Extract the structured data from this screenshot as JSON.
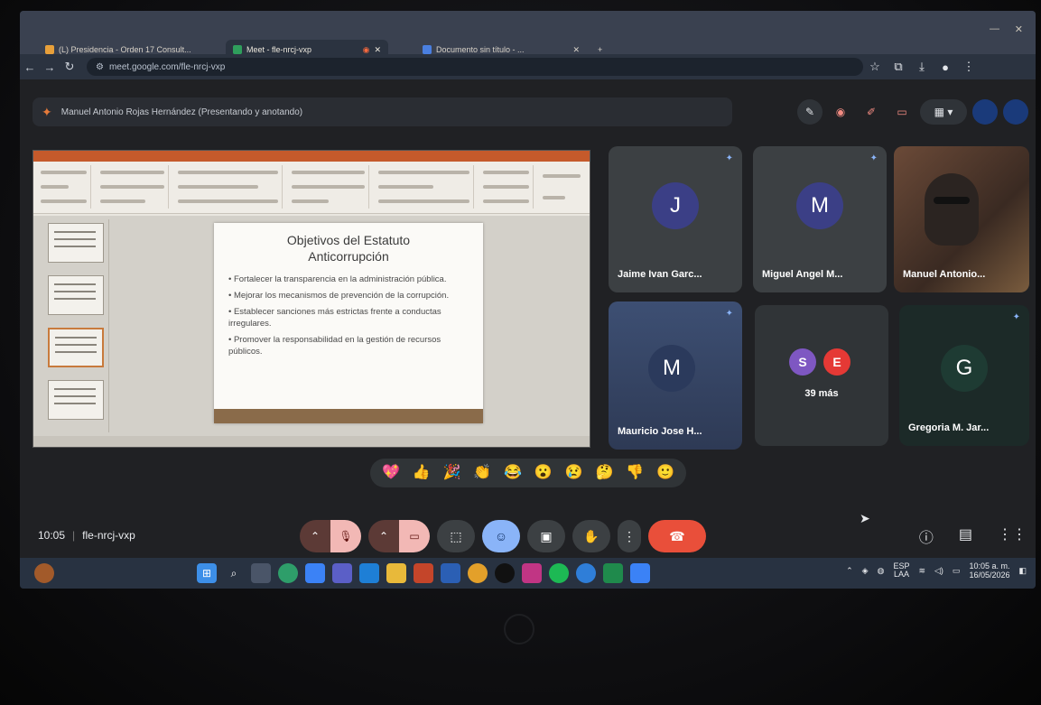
{
  "browser": {
    "tabs": [
      {
        "label": "(L) Presidencia - Orden 17 Consult..."
      },
      {
        "label": "Meet - fle-nrcj-vxp"
      },
      {
        "label": "Documento sin título - ..."
      }
    ],
    "new_tab": "+",
    "url": "meet.google.com/fle-nrcj-vxp"
  },
  "meet": {
    "presenter_text": "Manuel Antonio Rojas Hernández (Presentando y anotando)",
    "call_time": "10:05",
    "meeting_code": "fle-nrcj-vxp"
  },
  "slide": {
    "title_line1": "Objetivos del Estatuto",
    "title_line2": "Anticorrupción",
    "bullets": [
      "• Fortalecer la transparencia en la administración pública.",
      "• Mejorar los mecanismos de prevención de la corrupción.",
      "• Establecer sanciones más estrictas frente a conductas irregulares.",
      "• Promover la responsabilidad en la gestión de recursos públicos."
    ]
  },
  "participants": [
    {
      "initial": "J",
      "name": "Jaime Ivan Garc...",
      "color": "#3b3f86"
    },
    {
      "initial": "M",
      "name": "Miguel Angel M...",
      "color": "#3b3f86"
    },
    {
      "initial": "",
      "name": "Manuel Antonio...",
      "color": "#6b4a38"
    },
    {
      "initial": "M",
      "name": "Mauricio Jose H...",
      "color": "#3a4c72"
    },
    {
      "initial": "G",
      "name": "Gregoria M. Jar...",
      "color": "#1e3b33"
    }
  ],
  "more_tile": {
    "a": "S",
    "a_color": "#7e57c2",
    "b": "E",
    "b_color": "#e53935",
    "label": "39 más"
  },
  "reactions": [
    "💖",
    "👍",
    "🎉",
    "👏",
    "😂",
    "😮",
    "😢",
    "🤔",
    "👎",
    "🙂"
  ],
  "taskbar": {
    "lang_top": "ESP",
    "lang_bottom": "LAA",
    "time": "10:05 a. m.",
    "date": "16/05/2026"
  },
  "colors": {
    "leave": "#e94f3a",
    "active_ctrl": "#8ab4f8",
    "muted": "#f2b8b5"
  }
}
